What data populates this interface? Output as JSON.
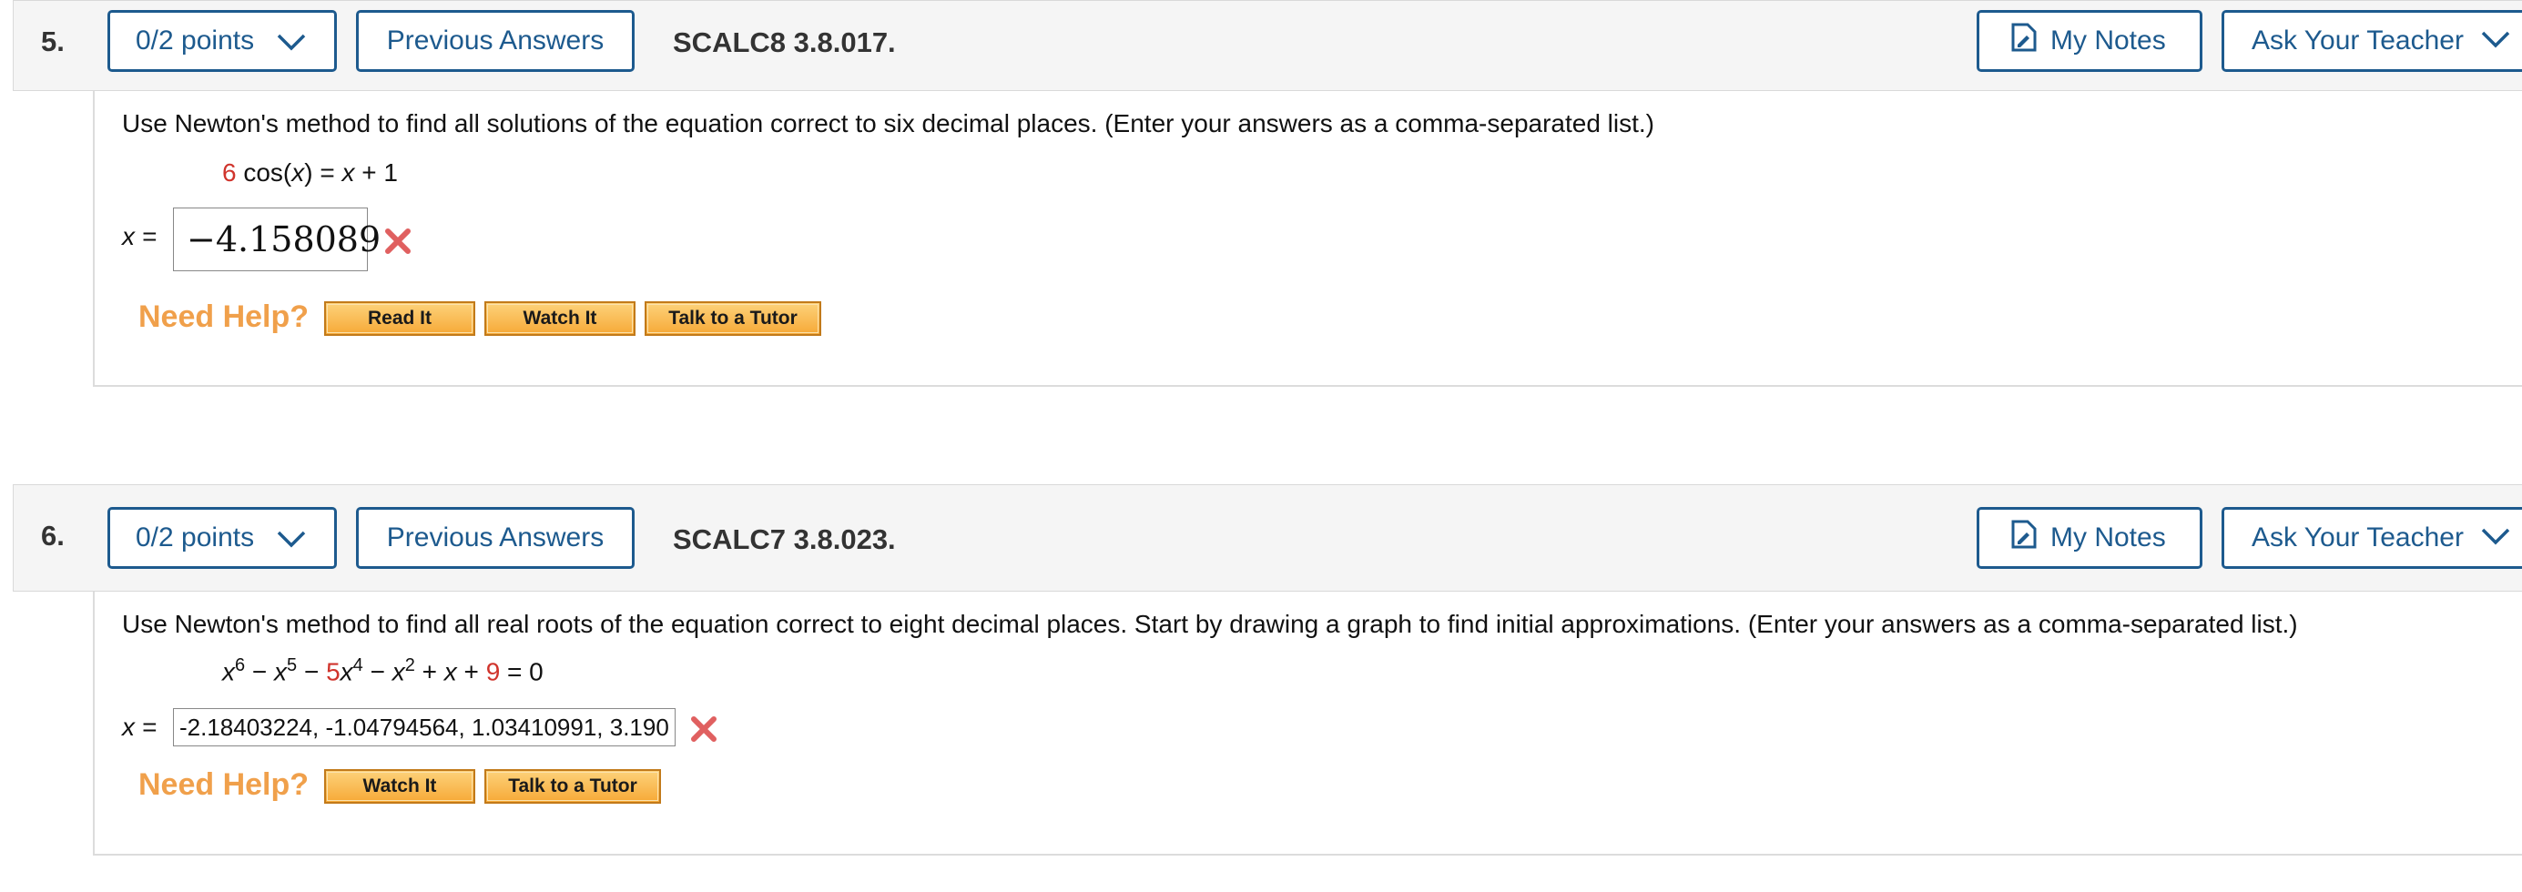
{
  "q5": {
    "number": "5.",
    "points_label": "0/2 points",
    "previous_answers": "Previous Answers",
    "source": "SCALC8 3.8.017.",
    "my_notes": "My Notes",
    "ask_teacher": "Ask Your Teacher",
    "prompt": "Use Newton's method to find all solutions of the equation correct to six decimal places. (Enter your answers as a comma-separated list.)",
    "equation": {
      "coef": "6",
      "lhs": "cos(",
      "var": "x",
      "lhs_close": ")",
      "eq": " = ",
      "rhs_var": "x",
      "rhs_rest": " + 1"
    },
    "answer_label": "x =",
    "answer_value": "−4.158089",
    "answer_status": "incorrect",
    "need_help": "Need Help?",
    "help_buttons": [
      "Read It",
      "Watch It",
      "Talk to a Tutor"
    ]
  },
  "q6": {
    "number": "6.",
    "points_label": "0/2 points",
    "previous_answers": "Previous Answers",
    "source": "SCALC7 3.8.023.",
    "my_notes": "My Notes",
    "ask_teacher": "Ask Your Teacher",
    "prompt": "Use Newton's method to find all real roots of the equation correct to eight decimal places. Start by drawing a graph to find initial approximations. (Enter your answers as a comma-separated list.)",
    "equation": {
      "x": "x",
      "p6": "6",
      "minus1": " − ",
      "p5": "5",
      "minus2": " − ",
      "coef5": "5",
      "p4": "4",
      "minus3": " − ",
      "p2": "2",
      "plus1": " + ",
      "plus2": " + ",
      "const": "9",
      "eq0": " = 0"
    },
    "answer_label": "x =",
    "answer_value": "-2.18403224, -1.04794564, 1.03410991, 3.190",
    "answer_status": "incorrect",
    "need_help": "Need Help?",
    "help_buttons": [
      "Watch It",
      "Talk to a Tutor"
    ]
  },
  "icons": {
    "chevron": "chevron-down-icon",
    "notes": "notes-icon",
    "incorrect": "x-mark-icon"
  },
  "colors": {
    "accent": "#1d5a8e",
    "error": "#e06060",
    "help": "#f0a04b",
    "highlight": "#d0342c"
  }
}
